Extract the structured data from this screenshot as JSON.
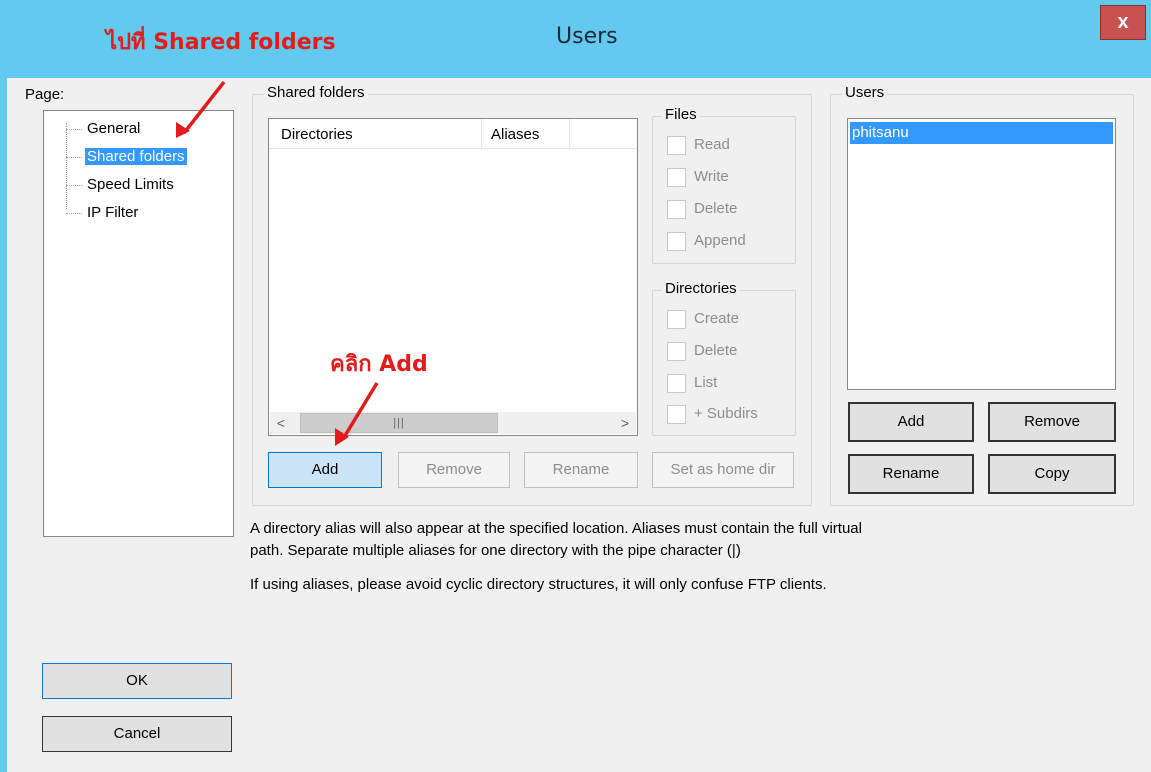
{
  "window": {
    "title": "Users",
    "close_label": "x"
  },
  "annotations": {
    "goto_shared": "ไปที่ Shared folders",
    "click_add": "คลิก Add",
    "color": "#e31b1b"
  },
  "page_panel": {
    "label": "Page:",
    "items": [
      {
        "label": "General",
        "selected": false
      },
      {
        "label": "Shared folders",
        "selected": true
      },
      {
        "label": "Speed Limits",
        "selected": false
      },
      {
        "label": "IP Filter",
        "selected": false
      }
    ]
  },
  "shared_folders": {
    "group_title": "Shared folders",
    "columns": [
      "Directories",
      "Aliases"
    ],
    "buttons": {
      "add": "Add",
      "remove": "Remove",
      "rename": "Rename",
      "set_home": "Set as home dir"
    }
  },
  "files_group": {
    "title": "Files",
    "options": [
      "Read",
      "Write",
      "Delete",
      "Append"
    ]
  },
  "directories_group": {
    "title": "Directories",
    "options": [
      "Create",
      "Delete",
      "List",
      "+ Subdirs"
    ]
  },
  "users_panel": {
    "title": "Users",
    "items": [
      "phitsanu"
    ],
    "buttons": {
      "add": "Add",
      "remove": "Remove",
      "rename": "Rename",
      "copy": "Copy"
    }
  },
  "info": {
    "line1": "A directory alias will also appear at the specified location. Aliases must contain the full virtual",
    "line2": "path. Separate multiple aliases for one directory with the pipe character (|)",
    "line3": "If using aliases, please avoid cyclic directory structures, it will only confuse FTP clients."
  },
  "dialog_buttons": {
    "ok": "OK",
    "cancel": "Cancel"
  },
  "colors": {
    "titlebar": "#63c9ee",
    "selection": "#3399ff",
    "close": "#c75050"
  }
}
